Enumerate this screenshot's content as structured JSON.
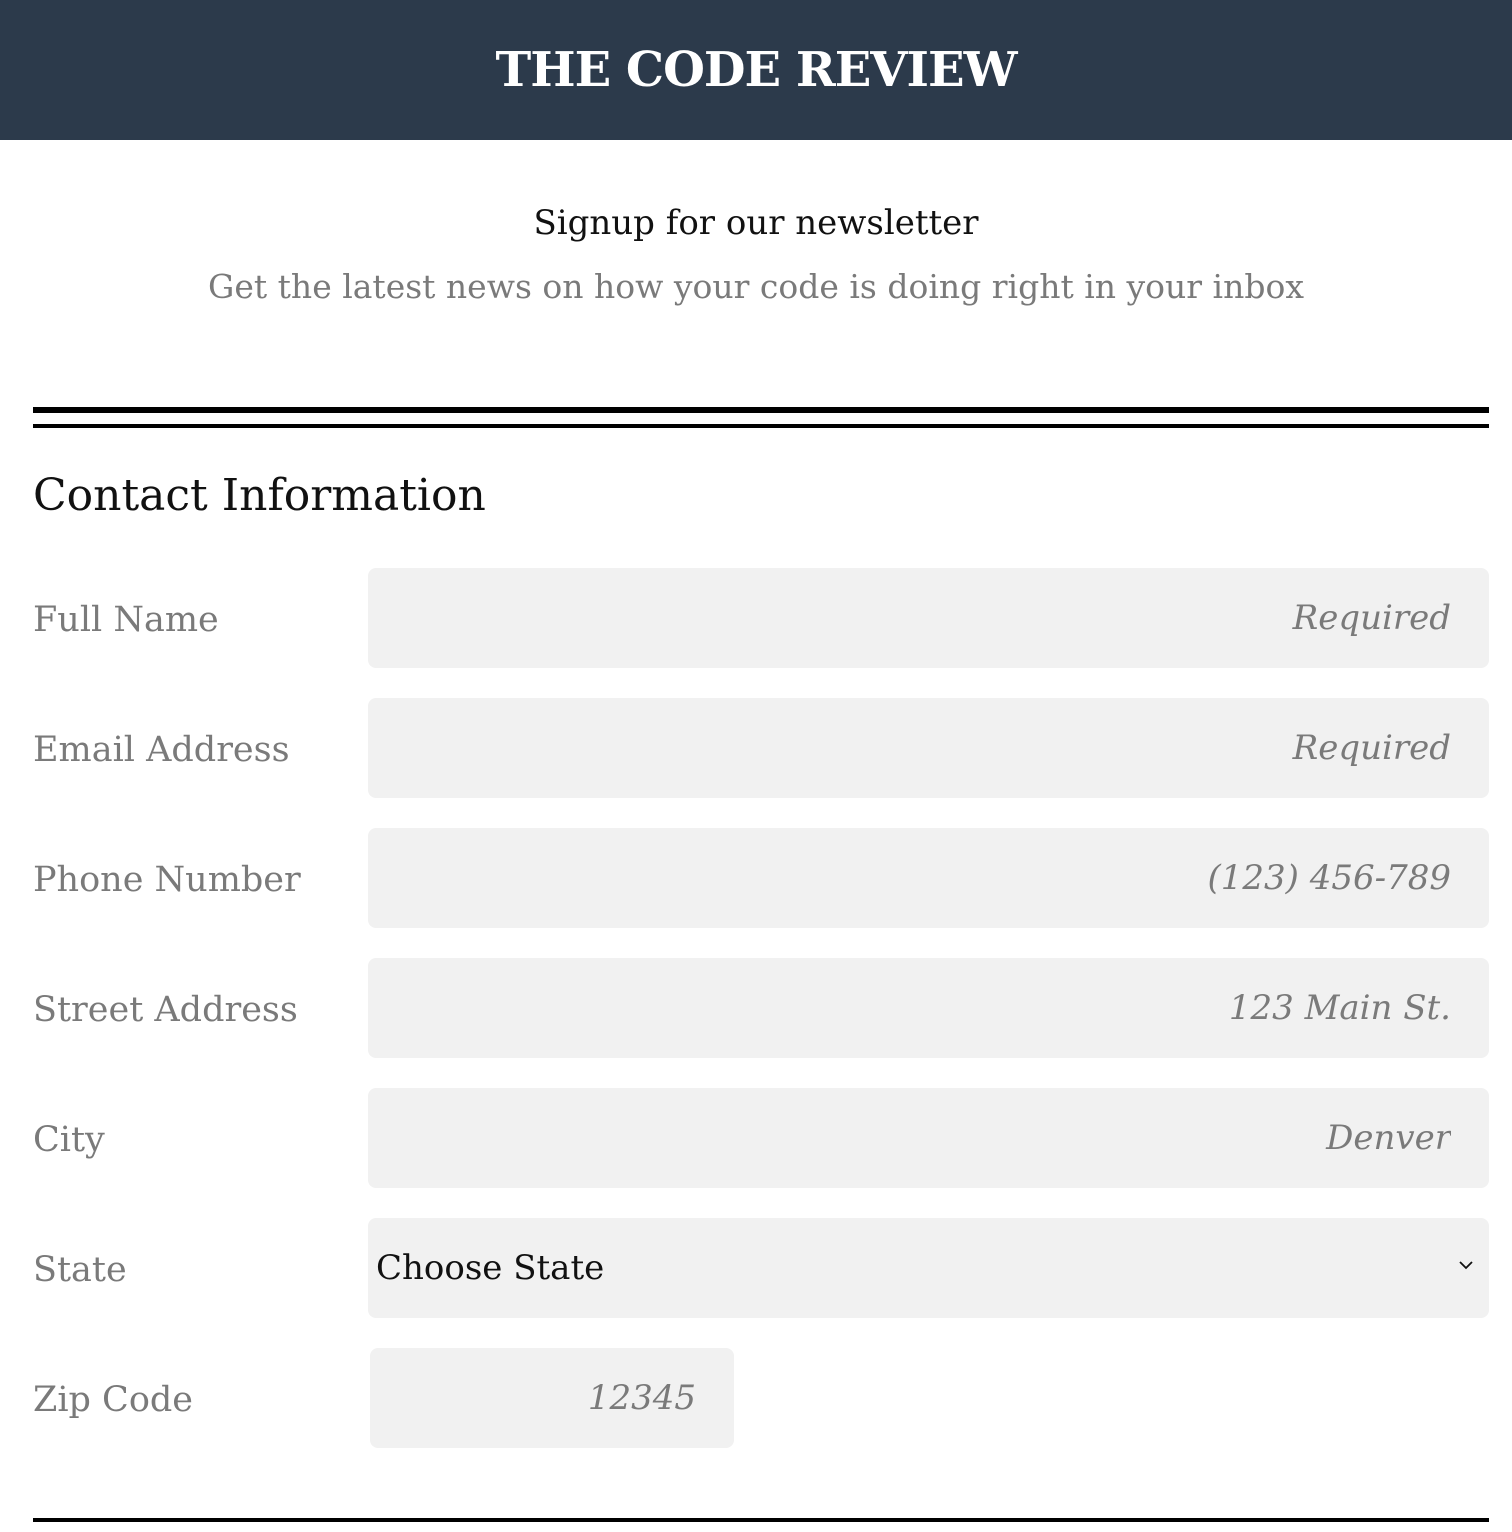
{
  "header": {
    "title": "THE CODE REVIEW",
    "background": "#2c3a4b"
  },
  "newsletter": {
    "title": "Signup for our newsletter",
    "subtitle": "Get the latest news on how your code is doing right in your inbox"
  },
  "contact": {
    "section_title": "Contact Information",
    "fields": [
      {
        "label": "Full Name",
        "placeholder": "Required"
      },
      {
        "label": "Email Address",
        "placeholder": "Required"
      },
      {
        "label": "Phone Number",
        "placeholder": "(123) 456-789"
      },
      {
        "label": "Street Address",
        "placeholder": "123 Main St."
      },
      {
        "label": "City",
        "placeholder": "Denver"
      }
    ],
    "state": {
      "label": "State",
      "selected": "Choose State",
      "icon": "chevron-down-icon"
    },
    "zip": {
      "label": "Zip Code",
      "placeholder": "12345"
    }
  }
}
